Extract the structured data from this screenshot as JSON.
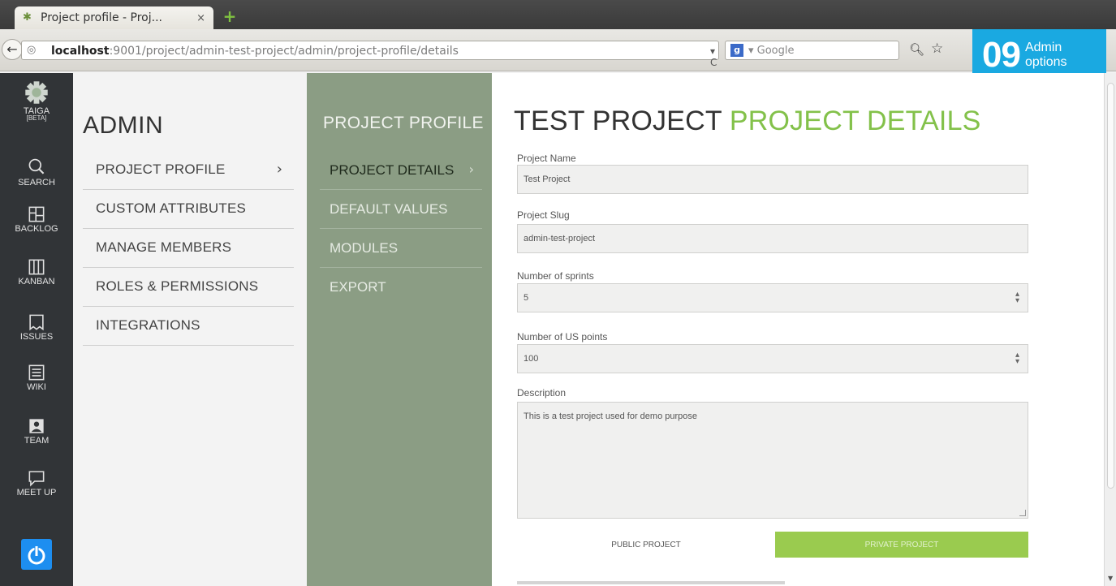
{
  "browser": {
    "tab_title": "Project profile - Proj...",
    "tab_close": "×",
    "new_tab": "+",
    "url_host": "localhost",
    "url_tail": ":9001/project/admin-test-project/admin/project-profile/details",
    "url_controls": "▾ C",
    "search_engine": "g",
    "search_placeholder": "▾ Google"
  },
  "badge": {
    "number": "09",
    "line1": "Admin",
    "line2": "options",
    "color": "#1aa9e1"
  },
  "rail": {
    "logo_label": "TAIGA",
    "logo_sub": "[BETA]",
    "items": [
      {
        "label": "SEARCH",
        "icon": "search-icon"
      },
      {
        "label": "BACKLOG",
        "icon": "backlog-icon"
      },
      {
        "label": "KANBAN",
        "icon": "kanban-icon"
      },
      {
        "label": "ISSUES",
        "icon": "issues-icon"
      },
      {
        "label": "WIKI",
        "icon": "wiki-icon"
      },
      {
        "label": "TEAM",
        "icon": "team-icon"
      },
      {
        "label": "MEET UP",
        "icon": "meetup-icon"
      }
    ]
  },
  "admin": {
    "title": "ADMIN",
    "items": [
      {
        "label": "PROJECT PROFILE",
        "chevron": "›"
      },
      {
        "label": "CUSTOM ATTRIBUTES"
      },
      {
        "label": "MANAGE MEMBERS"
      },
      {
        "label": "ROLES & PERMISSIONS"
      },
      {
        "label": "INTEGRATIONS"
      }
    ]
  },
  "project_profile": {
    "title": "PROJECT PROFILE",
    "items": [
      {
        "label": "PROJECT DETAILS",
        "chevron": "›"
      },
      {
        "label": "DEFAULT VALUES"
      },
      {
        "label": "MODULES"
      },
      {
        "label": "EXPORT"
      }
    ]
  },
  "main": {
    "title_project": "TEST PROJECT",
    "title_section": "PROJECT DETAILS",
    "fields": {
      "name": {
        "label": "Project Name",
        "value": "Test Project"
      },
      "slug": {
        "label": "Project Slug",
        "value": "admin-test-project"
      },
      "sprints": {
        "label": "Number of sprints",
        "value": "5"
      },
      "points": {
        "label": "Number of US points",
        "value": "100"
      },
      "description": {
        "label": "Description",
        "value": "This is a test project used for demo purpose"
      }
    },
    "toggle": {
      "public": "PUBLIC PROJECT",
      "private": "PRIVATE PROJECT"
    },
    "accent_color": "#83c14a"
  }
}
